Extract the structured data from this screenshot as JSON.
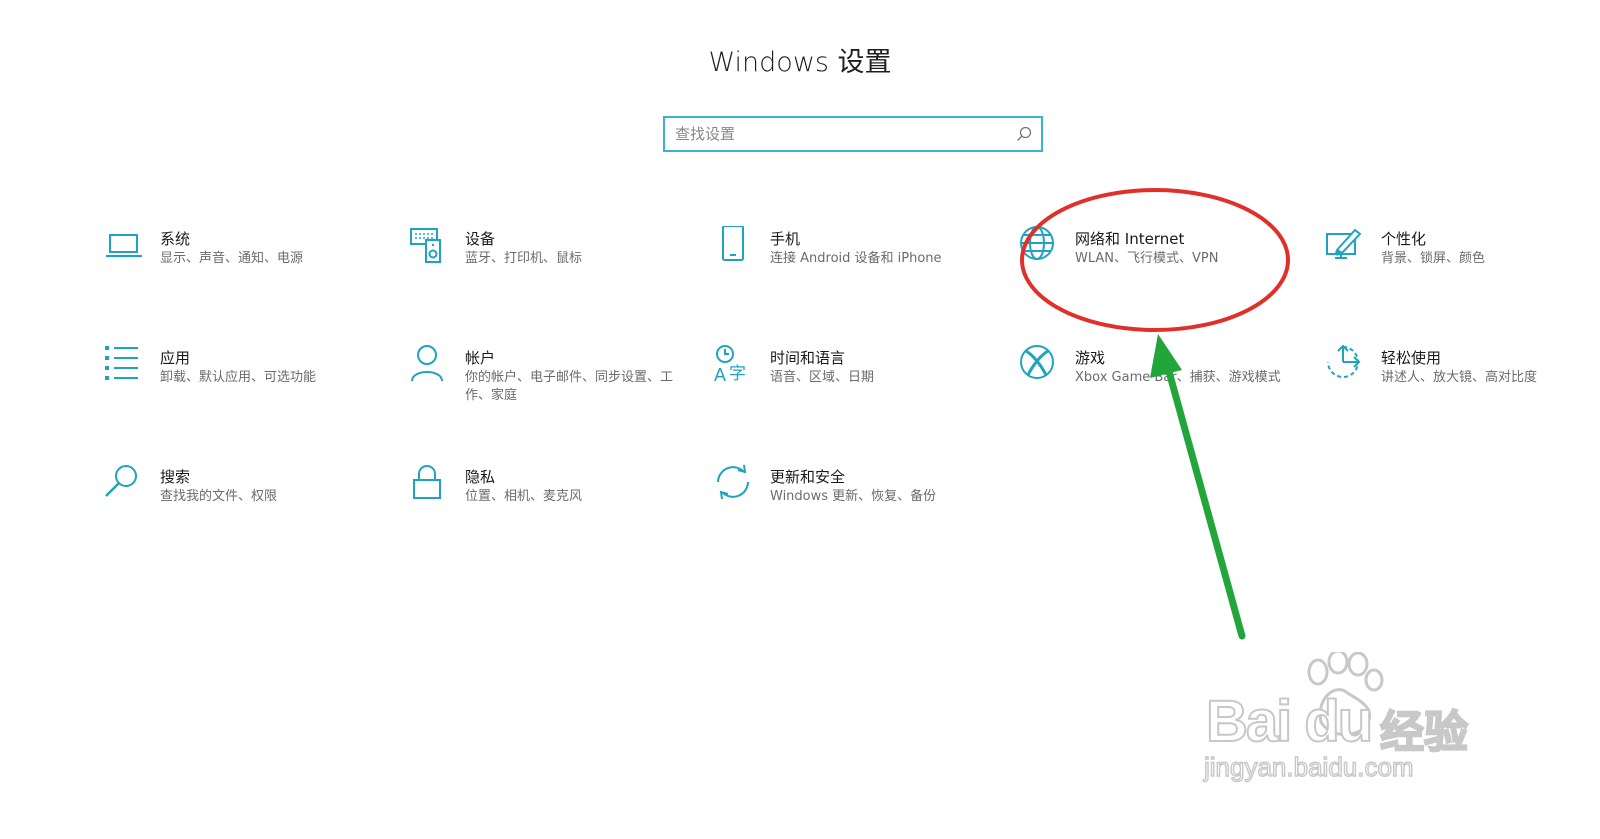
{
  "window": {
    "title": "Windows 设置"
  },
  "search": {
    "placeholder": "查找设置"
  },
  "accent_color": "#1fa3be",
  "tiles": [
    {
      "key": "system",
      "icon": "laptop-icon",
      "title": "系统",
      "desc": "显示、声音、通知、电源"
    },
    {
      "key": "devices",
      "icon": "devices-icon",
      "title": "设备",
      "desc": "蓝牙、打印机、鼠标"
    },
    {
      "key": "phone",
      "icon": "phone-icon",
      "title": "手机",
      "desc": "连接 Android 设备和 iPhone"
    },
    {
      "key": "network",
      "icon": "globe-icon",
      "title": "网络和 Internet",
      "desc": "WLAN、飞行模式、VPN"
    },
    {
      "key": "personalization",
      "icon": "paint-icon",
      "title": "个性化",
      "desc": "背景、锁屏、颜色"
    },
    {
      "key": "apps",
      "icon": "apps-list-icon",
      "title": "应用",
      "desc": "卸载、默认应用、可选功能"
    },
    {
      "key": "accounts",
      "icon": "person-icon",
      "title": "帐户",
      "desc": "你的帐户、电子邮件、同步设置、工作、家庭"
    },
    {
      "key": "time-language",
      "icon": "time-language-icon",
      "title": "时间和语言",
      "desc": "语音、区域、日期"
    },
    {
      "key": "gaming",
      "icon": "xbox-icon",
      "title": "游戏",
      "desc": "Xbox Game Bar、捕获、游戏模式"
    },
    {
      "key": "ease-of-access",
      "icon": "ease-of-access-icon",
      "title": "轻松使用",
      "desc": "讲述人、放大镜、高对比度"
    },
    {
      "key": "search",
      "icon": "search-icon",
      "title": "搜索",
      "desc": "查找我的文件、权限"
    },
    {
      "key": "privacy",
      "icon": "lock-icon",
      "title": "隐私",
      "desc": "位置、相机、麦克风"
    },
    {
      "key": "update-security",
      "icon": "update-icon",
      "title": "更新和安全",
      "desc": "Windows 更新、恢复、备份"
    }
  ],
  "annotation": {
    "circle_color": "#e0302a",
    "arrow_color": "#22a53a"
  },
  "watermark": {
    "brand": "Bai du",
    "brand_suffix": "经验",
    "url": "jingyan.baidu.com"
  }
}
